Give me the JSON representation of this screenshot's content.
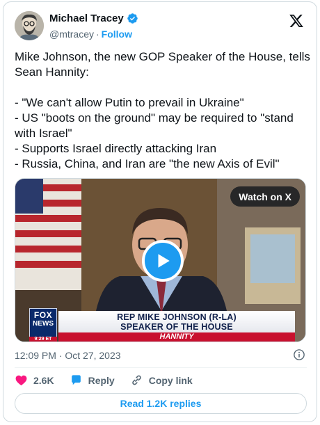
{
  "author": {
    "name": "Michael Tracey",
    "handle": "@mtracey",
    "separator": "·",
    "follow_label": "Follow",
    "verified_color": "#1d9bf0"
  },
  "tweet": {
    "text": "Mike Johnson, the new GOP Speaker of the House, tells Sean Hannity:\n\n- \"We can't allow Putin to prevail in Ukraine\"\n- US \"boots on the ground\" may be required to \"stand with Israel\"\n- Supports Israel directly attacking Iran\n- Russia, China, and Iran are \"the new Axis of Evil\""
  },
  "media": {
    "watch_label": "Watch on X",
    "chyron_line1": "REP MIKE JOHNSON (R-LA)",
    "chyron_line2": "SPEAKER OF THE HOUSE",
    "chyron_show": "HANNITY",
    "network_line1": "FOX",
    "network_line2": "NEWS",
    "network_time": "9:29 ET"
  },
  "timestamp": "12:09 PM · Oct 27, 2023",
  "actions": {
    "likes": "2.6K",
    "reply_label": "Reply",
    "copy_label": "Copy link"
  },
  "read_replies_label": "Read 1.2K replies",
  "colors": {
    "accent": "#1d9bf0",
    "like": "#f91880",
    "muted": "#536471",
    "chyron_red": "#c8102e",
    "fox_blue": "#0a2a6b"
  }
}
